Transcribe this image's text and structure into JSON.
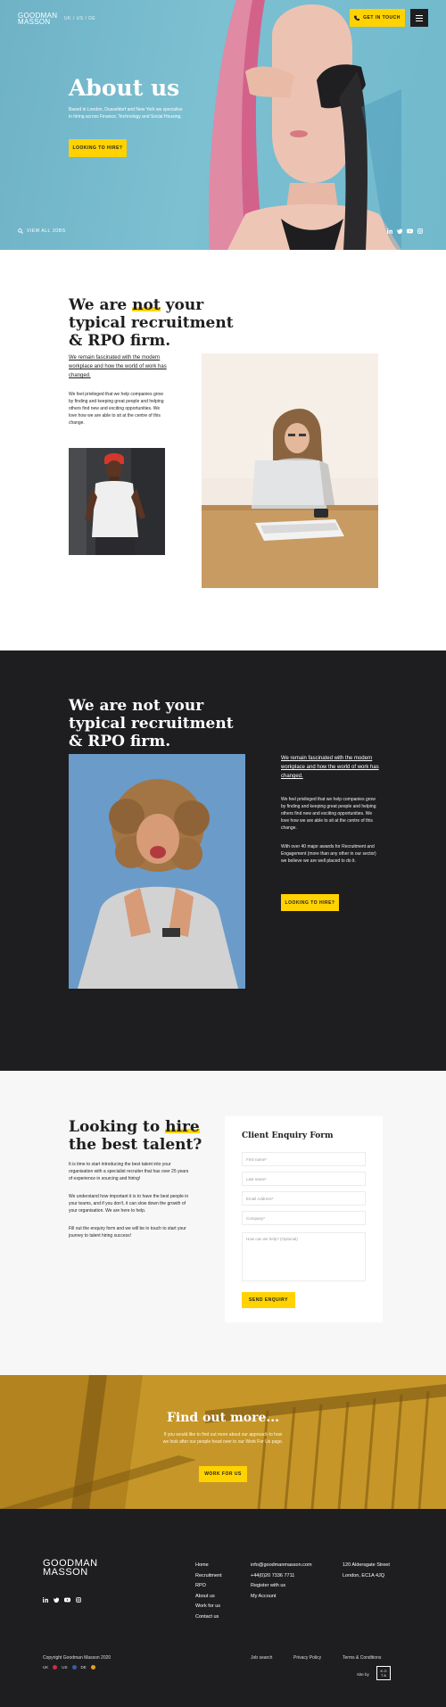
{
  "header": {
    "logo_line1": "GOODMAN",
    "logo_line2": "MASSON",
    "languages": "UK / US / DE",
    "get_in_touch": "GET IN TOUCH"
  },
  "hero": {
    "title": "About us",
    "text": "Based in London, Dusseldorf and New York we specialise in hiring across Finance, Technology and Social Housing.",
    "button": "LOOKING TO HIRE?",
    "view_jobs": "VIEW ALL JOBS",
    "social_icons": [
      "linkedin-icon",
      "twitter-icon",
      "youtube-icon",
      "instagram-icon"
    ]
  },
  "intro": {
    "title_pre": "We are ",
    "title_highlight": "not",
    "title_post": " your typical recruitment & RPO firm.",
    "lead": "We remain fascinated with the modern workplace and how the world of work has changed.",
    "body": "We feel privileged that we help companies grow by finding and keeping great people and helping others find new and exciting opportunities. We love how we are able to sit at the centre of this change."
  },
  "dark": {
    "title": "We are not your typical recruitment & RPO firm.",
    "lead": "We remain fascinated with the modern workplace and how the world of work has changed.",
    "body1": "We feel privileged that we help companies grow by finding and keeping great people and helping others find new and exciting opportunities. We love how we are able to sit at the centre of this change.",
    "body2": "With over 40 major awards for Recruitment and Engagement (more than any other in our sector) we believe we are well placed to do it.",
    "button": "LOOKING TO HIRE?"
  },
  "enquiry": {
    "title_pre": "Looking to ",
    "title_highlight": "hire",
    "title_post": " the best talent?",
    "p1": "It is time to start introducing the best talent into your organisation with a specialist recruiter that has over 25 years of experience in sourcing and hiring!",
    "p2": "We understand how important it is to have the best people in your teams, and if you don't, it can slow down the growth of your organisation. We are here to help.",
    "p3": "Fill out the enquiry form and we will be in touch to start your journey to talent hiring success!",
    "form": {
      "title": "Client Enquiry Form",
      "first_name": "First name*",
      "last_name": "Last name*",
      "email": "Email Address*",
      "company": "Company*",
      "message": "How can we help? (Optional)",
      "submit": "SEND ENQUIRY"
    }
  },
  "findout": {
    "title": "Find out more...",
    "text": "If you would like to find out more about our approach to how we look after our people head over to our Work For Us page.",
    "button": "WORK FOR US"
  },
  "footer": {
    "logo_line1": "GOODMAN",
    "logo_line2": "MASSON",
    "nav": [
      "Home",
      "Recruitment",
      "RPO",
      "About us",
      "Work for us",
      "Contact us"
    ],
    "contact": [
      "info@goodmanmasson.com",
      "+44(0)20 7336 7711",
      "Register with us",
      "My Account"
    ],
    "address_line1": "120 Aldersgate Street",
    "address_line2": "London, EC1A 4JQ",
    "copyright": "Copyright Goodman Masson 2020",
    "region_uk": "UK",
    "region_us": "US",
    "region_de": "DE",
    "job_search": "Job search",
    "privacy": "Privacy Policy",
    "terms": "Terms & Conditions",
    "site_by": "Site by",
    "kota": "K O T A",
    "social_icons": [
      "linkedin-icon",
      "twitter-icon",
      "youtube-icon",
      "instagram-icon"
    ]
  },
  "colors": {
    "accent": "#ffd200",
    "dark": "#1e1e20",
    "hero_bg": "#72b9cc",
    "findout_bg": "#b8891c"
  }
}
